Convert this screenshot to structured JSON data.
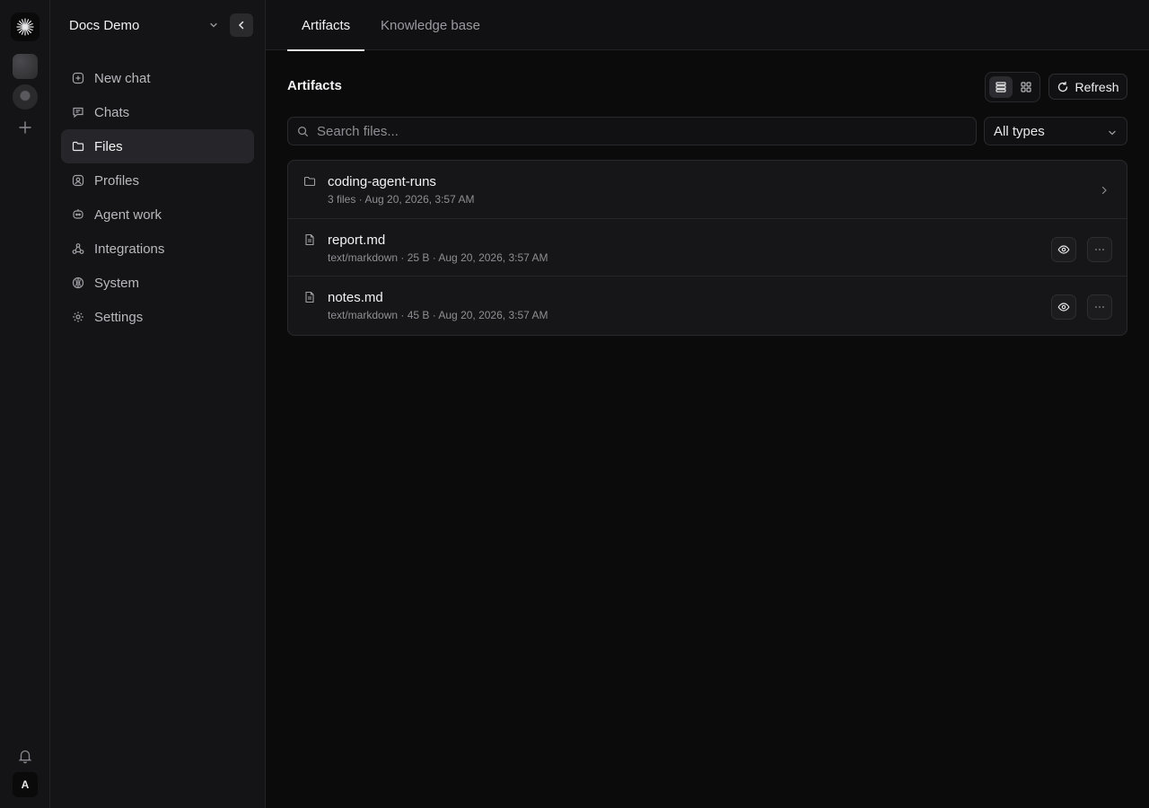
{
  "rail": {
    "logo_icon": "sparkle-logo-icon",
    "add_workspace_icon": "plus-icon",
    "notifications_icon": "bell-icon",
    "user_initial": "A"
  },
  "sidebar": {
    "workspace_name": "Docs Demo",
    "nav": [
      {
        "label": "New chat",
        "icon": "plus-circle-icon"
      },
      {
        "label": "Chats",
        "icon": "chat-icon"
      },
      {
        "label": "Files",
        "icon": "folder-icon",
        "active": true
      },
      {
        "label": "Profiles",
        "icon": "profile-icon"
      },
      {
        "label": "Agent work",
        "icon": "agent-icon"
      },
      {
        "label": "Integrations",
        "icon": "integrations-icon"
      },
      {
        "label": "System",
        "icon": "system-icon"
      },
      {
        "label": "Settings",
        "icon": "gear-icon"
      }
    ]
  },
  "tabs": [
    {
      "label": "Artifacts",
      "active": true
    },
    {
      "label": "Knowledge base",
      "active": false
    }
  ],
  "main": {
    "section_title": "Artifacts",
    "refresh_label": "Refresh",
    "search_placeholder": "Search files...",
    "type_filter": "All types"
  },
  "files": [
    {
      "name": "coding-agent-runs",
      "meta": "3 files · Aug 20, 2026, 3:57 AM",
      "kind": "folder"
    },
    {
      "name": "report.md",
      "meta": "text/markdown · 25 B · Aug 20, 2026, 3:57 AM",
      "kind": "file"
    },
    {
      "name": "notes.md",
      "meta": "text/markdown · 45 B · Aug 20, 2026, 3:57 AM",
      "kind": "file"
    }
  ]
}
